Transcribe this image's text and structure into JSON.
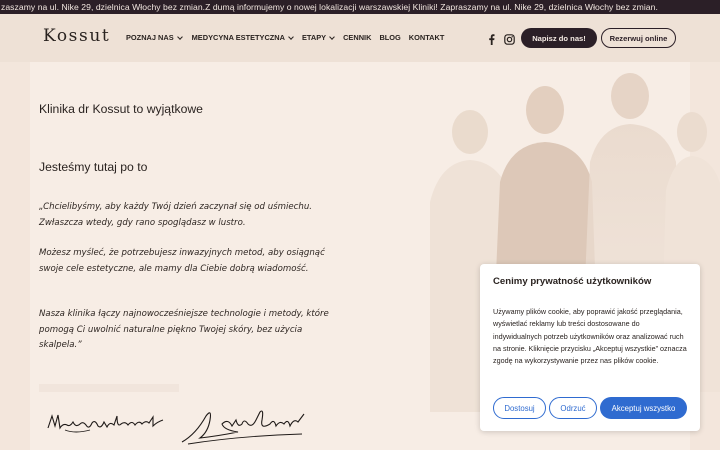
{
  "announcement": "zaszamy na ul. Nike 29, dzielnica Włochy bez zmian.Z dumą informujemy o nowej lokalizacji warszawskiej Kliniki! Zapraszamy na ul. Nike 29, dzielnica Włochy bez zmian.",
  "header": {
    "logo": "Kossut",
    "menu": [
      {
        "label": "POZNAJ NAS",
        "has_dropdown": true
      },
      {
        "label": "MEDYCYNA ESTETYCZNA",
        "has_dropdown": true
      },
      {
        "label": "ETAPY",
        "has_dropdown": true
      },
      {
        "label": "CENNIK",
        "has_dropdown": false
      },
      {
        "label": "BLOG",
        "has_dropdown": false
      },
      {
        "label": "KONTAKT",
        "has_dropdown": false
      }
    ],
    "social_icons": [
      "facebook-icon",
      "instagram-icon"
    ],
    "contact_button": "Napisz do nas!",
    "booking_button": "Rezerwuj online"
  },
  "content": {
    "intro_line1": "Klinika dr Kossut to wyjątkowe",
    "intro_line2": "Jesteśmy tutaj po to",
    "quote_p1": "„Chcielibyśmy, aby każdy Twój dzień zaczynał się od uśmiechu. Zwłaszcza wtedy, gdy rano spoglądasz w lustro.",
    "quote_p2": "Możesz myśleć, że potrzebujesz inwazyjnych metod, aby osiągnąć swoje cele estetyczne, ale mamy dla Ciebie dobrą wiadomość.",
    "quote_p3": "Nasza klinika łączy najnowocześniejsze technologie i metody, które pomogą Ci uwolnić naturalne piękno Twojej skóry, bez użycia skalpela.”",
    "signature_1": "Małgorzata Kossut",
    "signature_2": "Adam Kossut"
  },
  "cookie_banner": {
    "title": "Cenimy prywatność użytkowników",
    "text": "Używamy plików cookie, aby poprawić jakość przeglądania, wyświetlać reklamy lub treści dostosowane do indywidualnych potrzeb użytkowników oraz analizować ruch na stronie. Kliknięcie przycisku „Akceptuj wszystkie” oznacza zgodę na wykorzystywanie przez nas plików cookie.",
    "customize_button": "Dostosuj",
    "reject_button": "Odrzuć",
    "accept_button": "Akceptuj wszystko"
  },
  "colors": {
    "background": "#f3e6dc",
    "dark": "#2b1f27",
    "accent_blue": "#2f6bd0"
  }
}
